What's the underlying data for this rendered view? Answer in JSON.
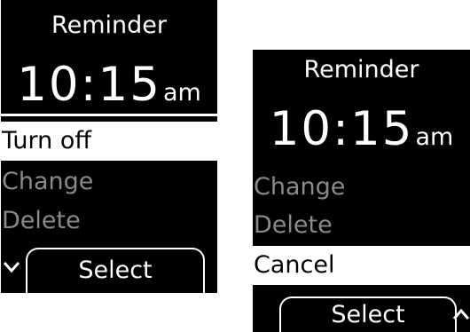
{
  "screen_1": {
    "title": "Reminder",
    "time": "10:15",
    "ampm": "am",
    "menu": [
      {
        "label": "Turn off",
        "state": "selected"
      },
      {
        "label": "Change",
        "state": "normal"
      },
      {
        "label": "Delete",
        "state": "normal"
      }
    ],
    "softkey_label": "Select",
    "scroll_icon": "chevron-down-icon"
  },
  "screen_2": {
    "title": "Reminder",
    "time": "10:15",
    "ampm": "am",
    "menu": [
      {
        "label": "Change",
        "state": "normal"
      },
      {
        "label": "Delete",
        "state": "normal"
      },
      {
        "label": "Cancel",
        "state": "selected"
      }
    ],
    "softkey_label": "Select",
    "scroll_icon": "chevron-up-icon"
  },
  "colors": {
    "background": "#000000",
    "foreground": "#ffffff",
    "dimmed_text": "#8a8a8a"
  }
}
